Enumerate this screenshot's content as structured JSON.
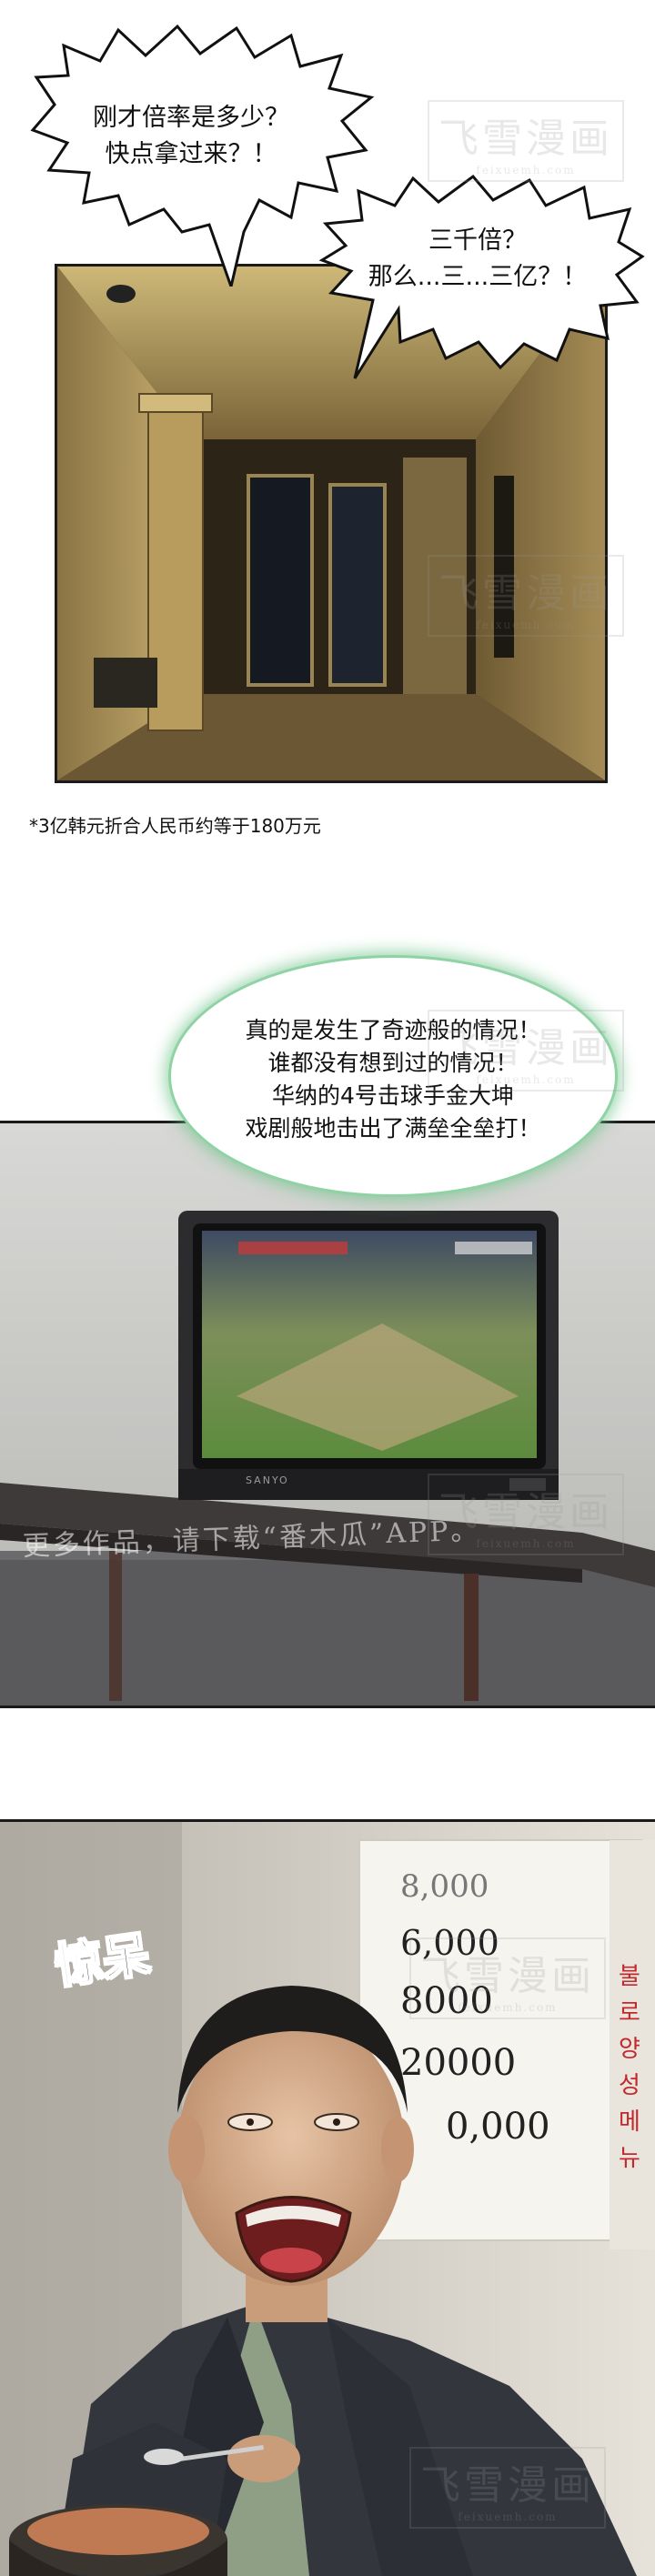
{
  "panel1": {
    "bubble_left_lines": [
      "刚才倍率是多少？",
      "快点拿过来？！"
    ],
    "bubble_right_lines": [
      "三千倍？",
      "那么...三...三亿？！"
    ]
  },
  "footnote": "*3亿韩元折合人民币约等于180万元",
  "panel2": {
    "narration_lines": [
      "真的是发生了奇迹般的情况！",
      "谁都没有想到过的情况！",
      "华纳的4号击球手金大坤",
      "戏剧般地击出了满垒全垒打！"
    ],
    "tv_brand": "SANYO",
    "promo": "更多作品，请下载“番木瓜”APP。"
  },
  "panel3": {
    "sfx": "惊呆",
    "board_numbers": [
      "8,000",
      "6,000",
      "8000",
      "20000",
      "0,000"
    ],
    "board_side_text": "불 로 양 성 메 뉴"
  },
  "watermark": {
    "text": "飞雪漫画",
    "sub": "feixuemh.com"
  },
  "colors": {
    "bubble_green": "#6fc489",
    "panel_border": "#1a1a1a"
  }
}
